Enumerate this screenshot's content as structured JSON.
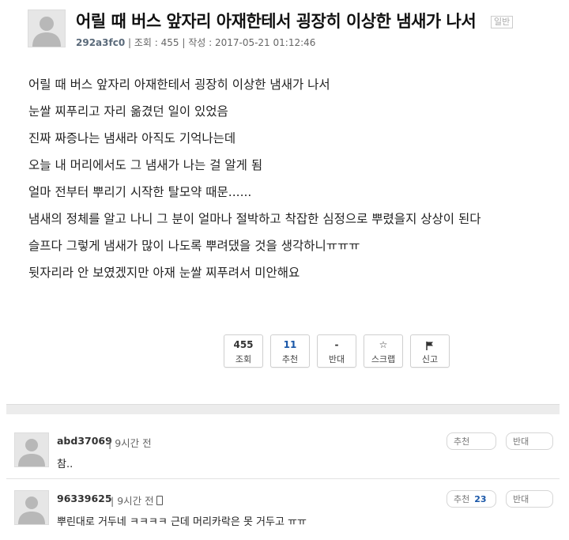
{
  "post": {
    "title": "어릴 때 버스 앞자리 아재한테서 굉장히 이상한 냄새가 나서",
    "category": "일반",
    "author": "292a3fc0",
    "views_label": "조회 : 455",
    "date_label": "작성 : 2017-05-21 01:12:46",
    "body_lines": [
      "어릴 때 버스 앞자리 아재한테서 굉장히 이상한 냄새가 나서",
      "눈쌀 찌푸리고 자리 옮겼던 일이 있었음",
      "진짜 짜증나는 냄새라 아직도 기억나는데",
      "오늘 내 머리에서도 그 냄새가 나는 걸 알게 됨",
      "얼마 전부터 뿌리기 시작한 탈모약 때문......",
      "냄새의 정체를 알고 나니 그 분이 얼마나 절박하고 착잡한 심정으로 뿌렸을지 상상이 된다",
      "슬프다 그렇게 냄새가 많이 나도록 뿌려댔을 것을 생각하니ㅠㅠㅠ",
      "뒷자리라 안 보였겠지만 아재 눈쌀 찌푸려서 미안해요"
    ]
  },
  "actions": {
    "views": {
      "top": "455",
      "label": "조회"
    },
    "recommend": {
      "top": "11",
      "label": "추천"
    },
    "oppose": {
      "top": "-",
      "label": "반대"
    },
    "scrap": {
      "icon": "star-icon",
      "top": "☆",
      "label": "스크랩"
    },
    "report": {
      "icon": "flag-icon",
      "label": "신고"
    }
  },
  "comments": [
    {
      "author": "abd37069",
      "time": "9시간 전",
      "text": "참..",
      "recommend_label": "추천",
      "recommend_count": "",
      "oppose_label": "반대"
    },
    {
      "author": "96339625",
      "time": "9시간 전",
      "text": "뿌린대로 거두네 ㅋㅋㅋㅋ 근데 머리카락은 못 거두고 ㅠㅠ",
      "recommend_label": "추천",
      "recommend_count": "23",
      "oppose_label": "반대",
      "device_icon": "mobile-phone-icon"
    }
  ],
  "colors": {
    "accent_blue": "#1a57a8",
    "divider_gray": "#ececec"
  }
}
